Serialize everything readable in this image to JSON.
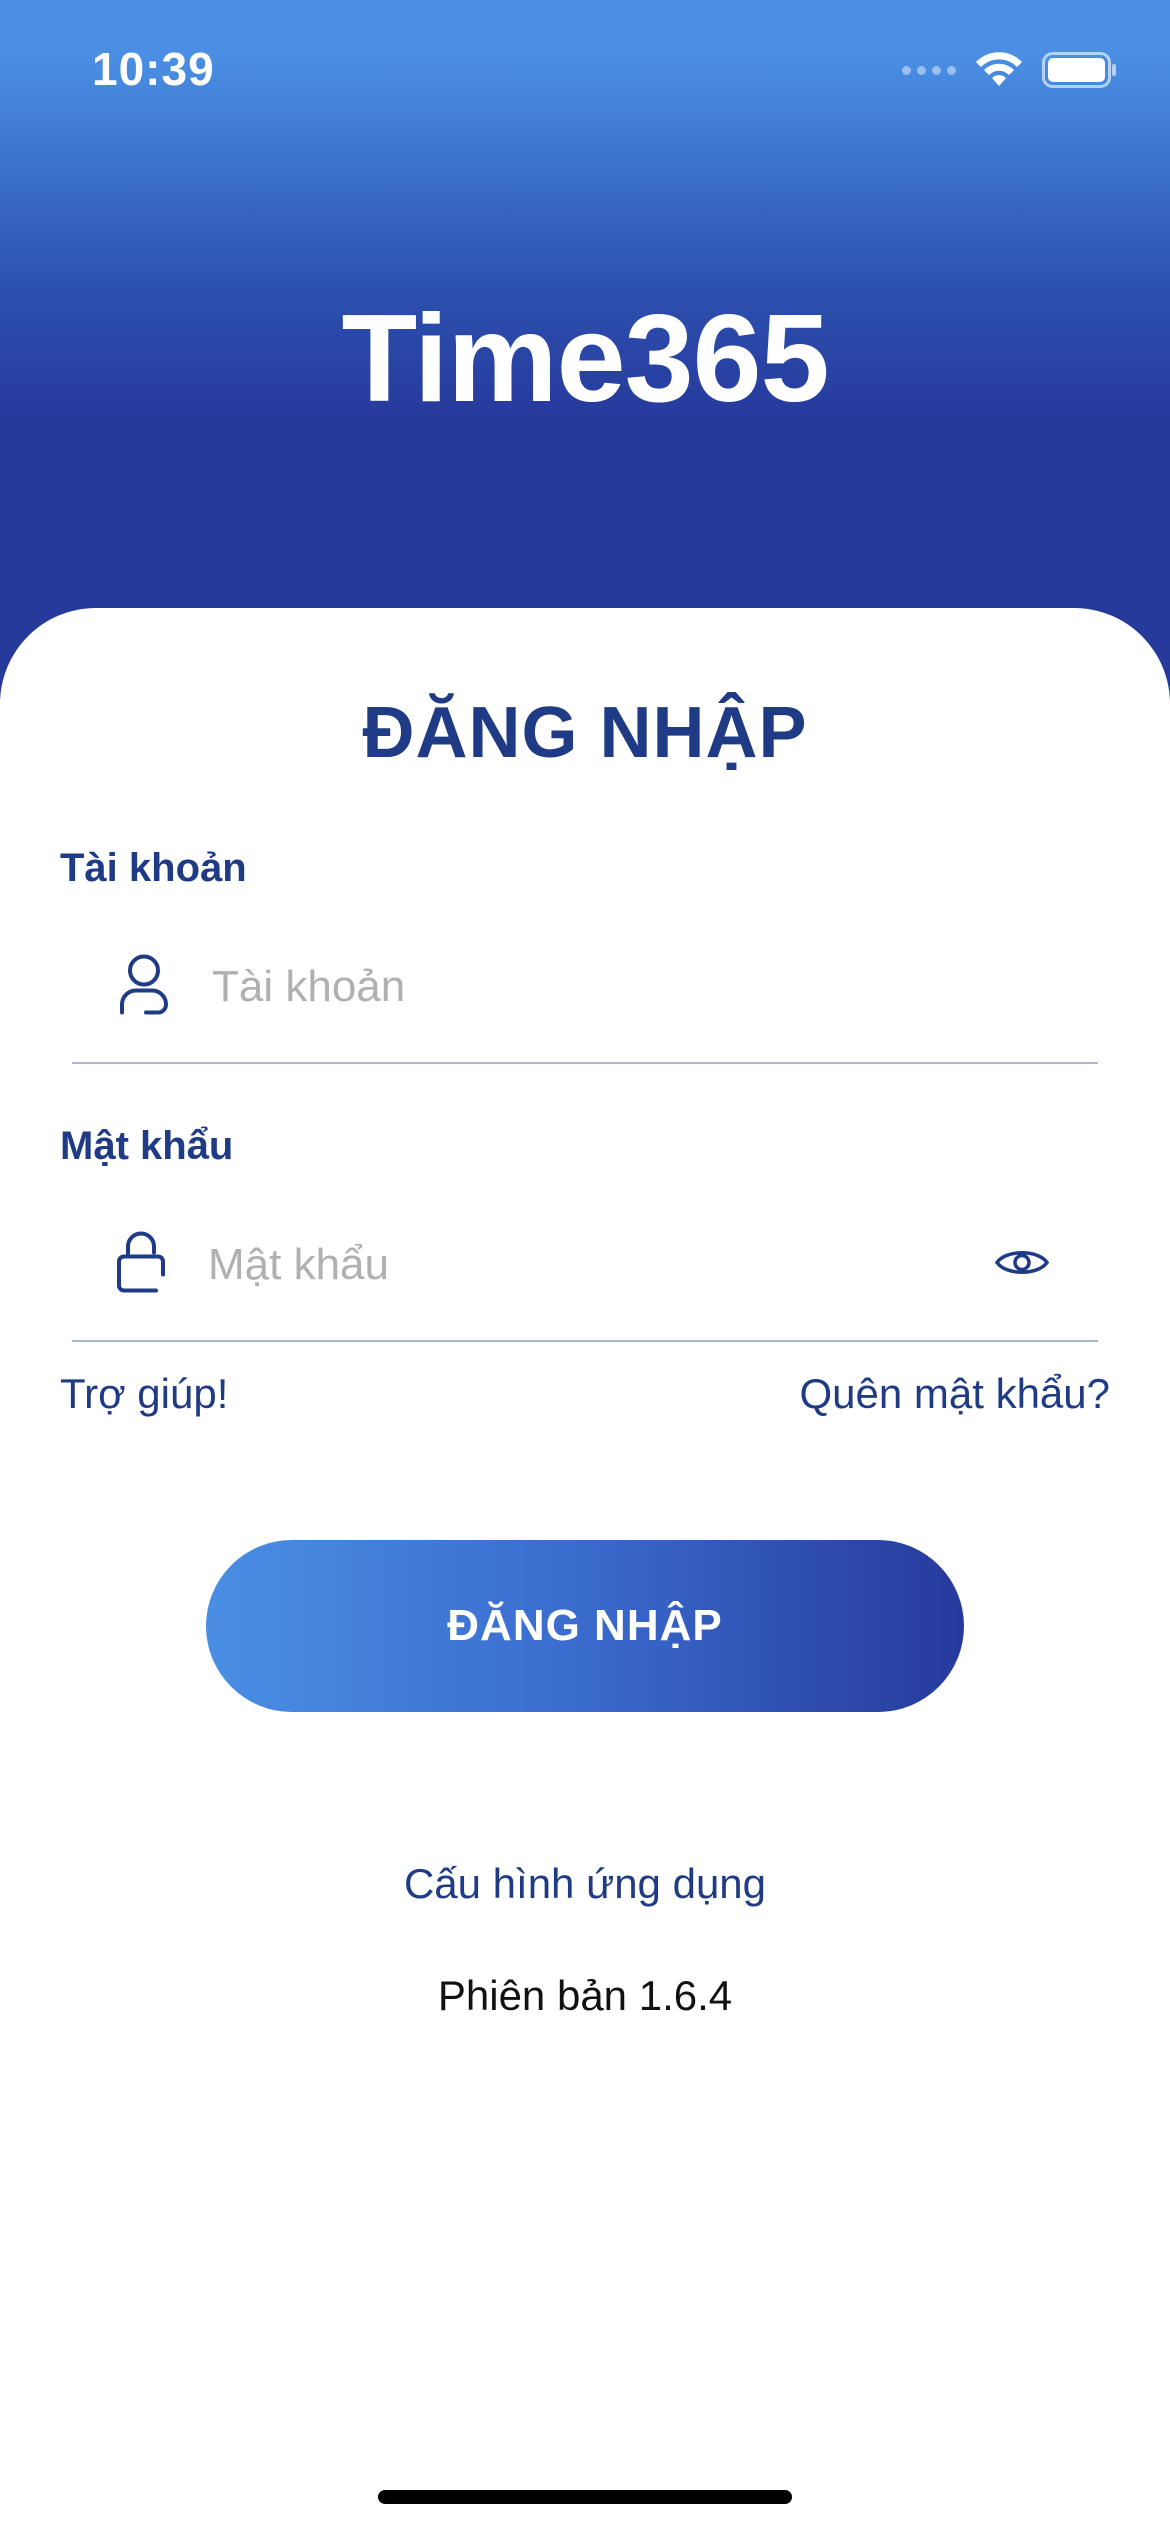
{
  "status_bar": {
    "time": "10:39"
  },
  "app": {
    "title": "Time365"
  },
  "login": {
    "heading": "ĐĂNG NHẬP",
    "username": {
      "label": "Tài khoản",
      "placeholder": "Tài khoản",
      "value": ""
    },
    "password": {
      "label": "Mật khẩu",
      "placeholder": "Mật khẩu",
      "value": ""
    },
    "help_link": "Trợ giúp!",
    "forgot_link": "Quên mật khẩu?",
    "submit_label": "ĐĂNG NHẬP"
  },
  "footer": {
    "config_link": "Cấu hình ứng dụng",
    "version": "Phiên bản 1.6.4"
  },
  "colors": {
    "brand_dark": "#263a9c",
    "brand_light": "#4a8fe4",
    "text_primary": "#1f3b86"
  },
  "icons": {
    "user": "user-icon",
    "lock": "lock-icon",
    "eye": "eye-icon",
    "wifi": "wifi-icon",
    "battery": "battery-icon"
  }
}
